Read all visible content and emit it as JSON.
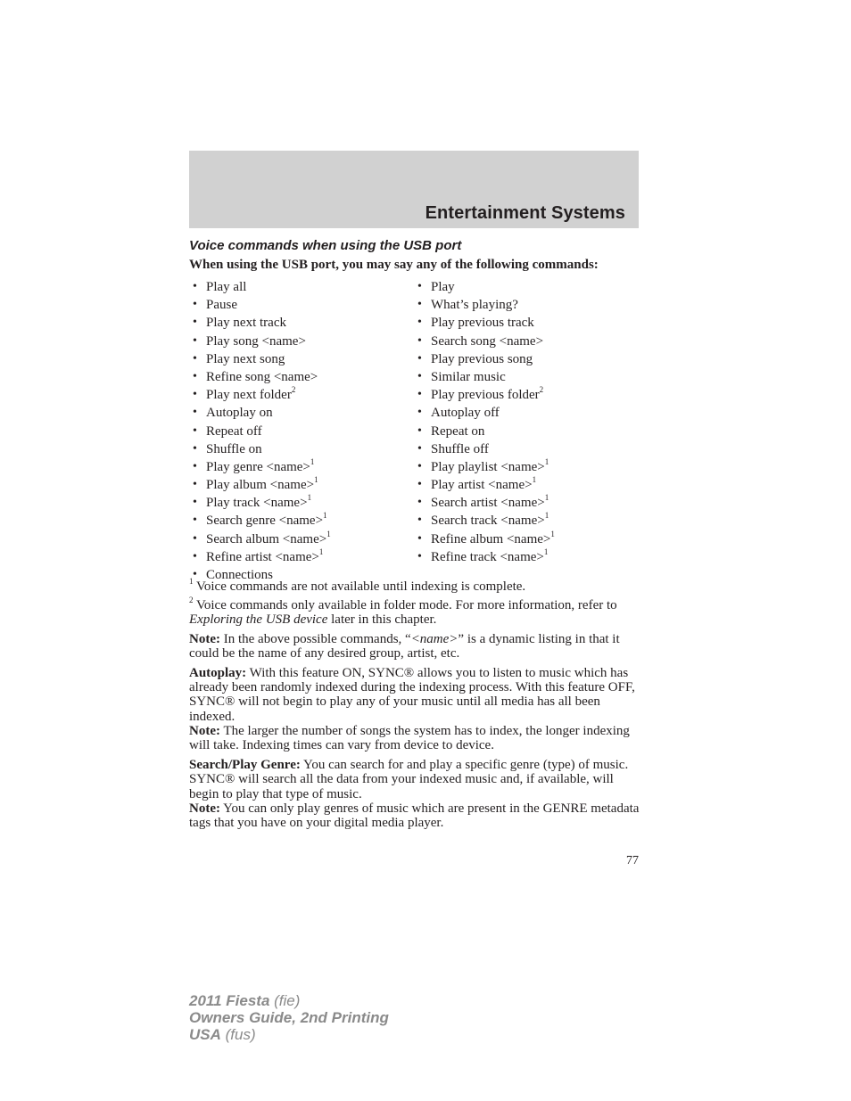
{
  "header": {
    "title": "Entertainment Systems"
  },
  "section": {
    "title": "Voice commands when using the USB port",
    "intro": "When using the USB port, you may say any of the following commands:"
  },
  "commands": {
    "left": [
      {
        "text": "Play all",
        "sup": ""
      },
      {
        "text": "Pause",
        "sup": ""
      },
      {
        "text": "Play next track",
        "sup": ""
      },
      {
        "text": "Play song <name>",
        "sup": ""
      },
      {
        "text": "Play next song",
        "sup": ""
      },
      {
        "text": "Refine song <name>",
        "sup": ""
      },
      {
        "text": "Play next folder",
        "sup": "2"
      },
      {
        "text": "Autoplay on",
        "sup": ""
      },
      {
        "text": "Repeat off",
        "sup": ""
      },
      {
        "text": "Shuffle on",
        "sup": ""
      },
      {
        "text": "Play genre <name>",
        "sup": "1"
      },
      {
        "text": "Play album <name>",
        "sup": "1"
      },
      {
        "text": "Play track <name>",
        "sup": "1"
      },
      {
        "text": "Search genre <name>",
        "sup": "1"
      },
      {
        "text": "Search album <name>",
        "sup": "1"
      },
      {
        "text": "Refine artist <name>",
        "sup": "1"
      },
      {
        "text": "Connections",
        "sup": ""
      }
    ],
    "right": [
      {
        "text": "Play",
        "sup": ""
      },
      {
        "text": "What’s playing?",
        "sup": ""
      },
      {
        "text": "Play previous track",
        "sup": ""
      },
      {
        "text": "Search song <name>",
        "sup": ""
      },
      {
        "text": "Play previous song",
        "sup": ""
      },
      {
        "text": "Similar music",
        "sup": ""
      },
      {
        "text": "Play previous folder",
        "sup": "2"
      },
      {
        "text": "Autoplay off",
        "sup": ""
      },
      {
        "text": "Repeat on",
        "sup": ""
      },
      {
        "text": "Shuffle off",
        "sup": ""
      },
      {
        "text": "Play playlist <name>",
        "sup": "1"
      },
      {
        "text": "Play artist <name>",
        "sup": "1"
      },
      {
        "text": "Search artist <name>",
        "sup": "1"
      },
      {
        "text": "Search track <name>",
        "sup": "1"
      },
      {
        "text": "Refine album <name>",
        "sup": "1"
      },
      {
        "text": "Refine track <name>",
        "sup": "1"
      }
    ],
    "bullet": "•"
  },
  "footnotes": {
    "fn1_mark": "1",
    "fn1_text": " Voice commands are not available until indexing is complete.",
    "fn2_mark": "2",
    "fn2_text_a": " Voice commands only available in folder mode. For more information, refer to ",
    "fn2_link": "Exploring the USB device",
    "fn2_text_b": " later in this chapter."
  },
  "note1": {
    "label": "Note:",
    "text_a": " In the above possible commands, “",
    "name": "<name>",
    "text_b": "” is a dynamic listing in that it could be the name of any desired group, artist, etc."
  },
  "autoplay": {
    "label": "Autoplay:",
    "text": " With this feature ON, SYNC® allows you to listen to music which has already been randomly indexed during the indexing process. With this feature OFF, SYNC® will not begin to play any of your music until all media has all been indexed.",
    "note_label": "Note:",
    "note_text": " The larger the number of songs the system has to index, the longer indexing will take. Indexing times can vary from device to device."
  },
  "genre": {
    "label": "Search/Play Genre:",
    "text": " You can search for and play a specific genre (type) of music. SYNC® will search all the data from your indexed music and, if available, will begin to play that type of music.",
    "note_label": "Note:",
    "note_text": " You can only play genres of music which are present in the GENRE metadata tags that you have on your digital media player."
  },
  "page_number": "77",
  "footer": {
    "line1_bold": "2011 Fiesta",
    "line1_code": " (fie)",
    "line2_bold": "Owners Guide, 2nd Printing",
    "line3_bold": "USA",
    "line3_code": " (fus)"
  }
}
